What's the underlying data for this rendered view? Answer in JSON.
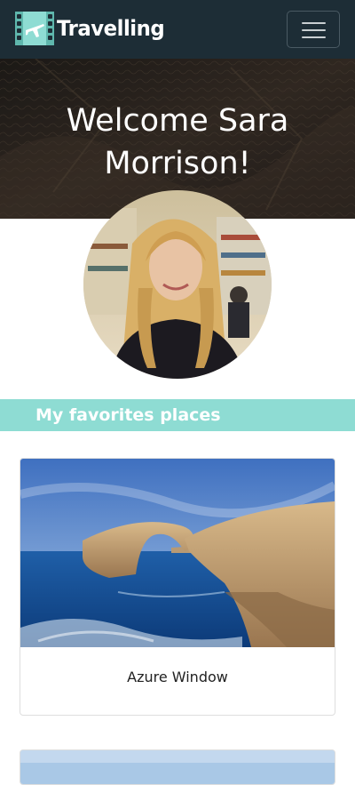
{
  "navbar": {
    "brand_text": "Travelling",
    "logo_icon": "film-airplane-logo-icon",
    "menu_icon": "hamburger-menu-icon",
    "background_color": "#1d2d36"
  },
  "hero": {
    "title": "Welcome Sara Morrison!"
  },
  "profile": {
    "avatar_icon": "profile-photo"
  },
  "favorites": {
    "section_title": "My favorites places",
    "accent_color": "#8edcd3",
    "places": [
      {
        "name": "Azure Window"
      },
      {
        "name": ""
      }
    ]
  }
}
